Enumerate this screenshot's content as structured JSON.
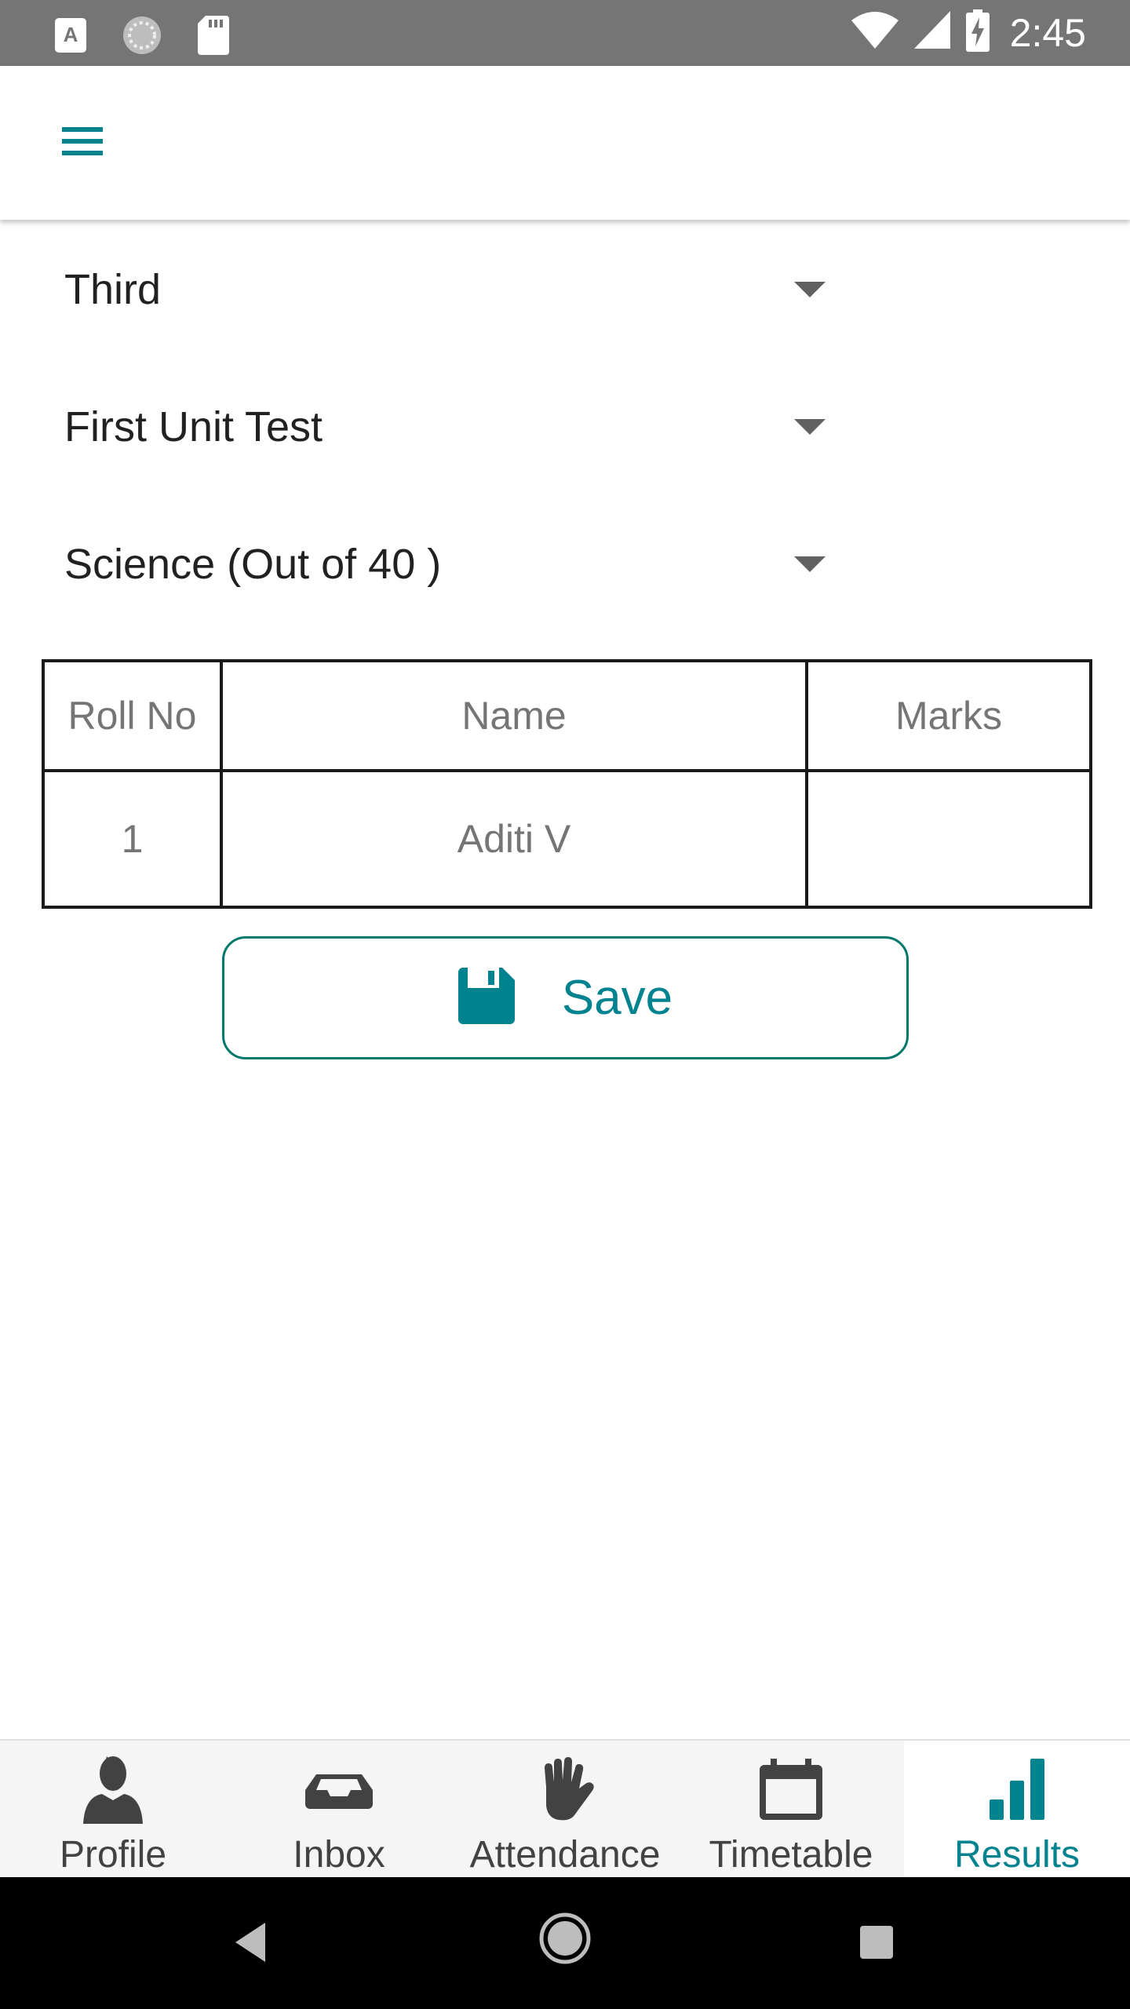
{
  "status_bar": {
    "time": "2:45",
    "icons": [
      "text-a-icon",
      "sync-circle-icon",
      "sd-card-icon",
      "wifi-icon",
      "signal-icon",
      "battery-charging-icon"
    ]
  },
  "app_bar": {
    "menu_icon": "hamburger-menu-icon"
  },
  "filters": {
    "class_value": "Third",
    "exam_value": "First Unit Test",
    "subject_value": "Science (Out of 40 )"
  },
  "table": {
    "headers": [
      "Roll No",
      "Name",
      "Marks"
    ],
    "rows": [
      {
        "roll_no": "1",
        "name": "Aditi V",
        "marks": ""
      }
    ]
  },
  "save_button": {
    "label": "Save",
    "icon": "floppy-disk-icon"
  },
  "bottom_nav": {
    "items": [
      {
        "label": "Profile",
        "icon": "person-icon"
      },
      {
        "label": "Inbox",
        "icon": "inbox-tray-icon"
      },
      {
        "label": "Attendance",
        "icon": "raised-hand-icon"
      },
      {
        "label": "Timetable",
        "icon": "calendar-icon"
      },
      {
        "label": "Results",
        "icon": "bar-chart-icon"
      }
    ],
    "active": "Results"
  },
  "colors": {
    "accent": "#00838f",
    "status_bar": "#757575",
    "nav_inactive": "#424242"
  }
}
